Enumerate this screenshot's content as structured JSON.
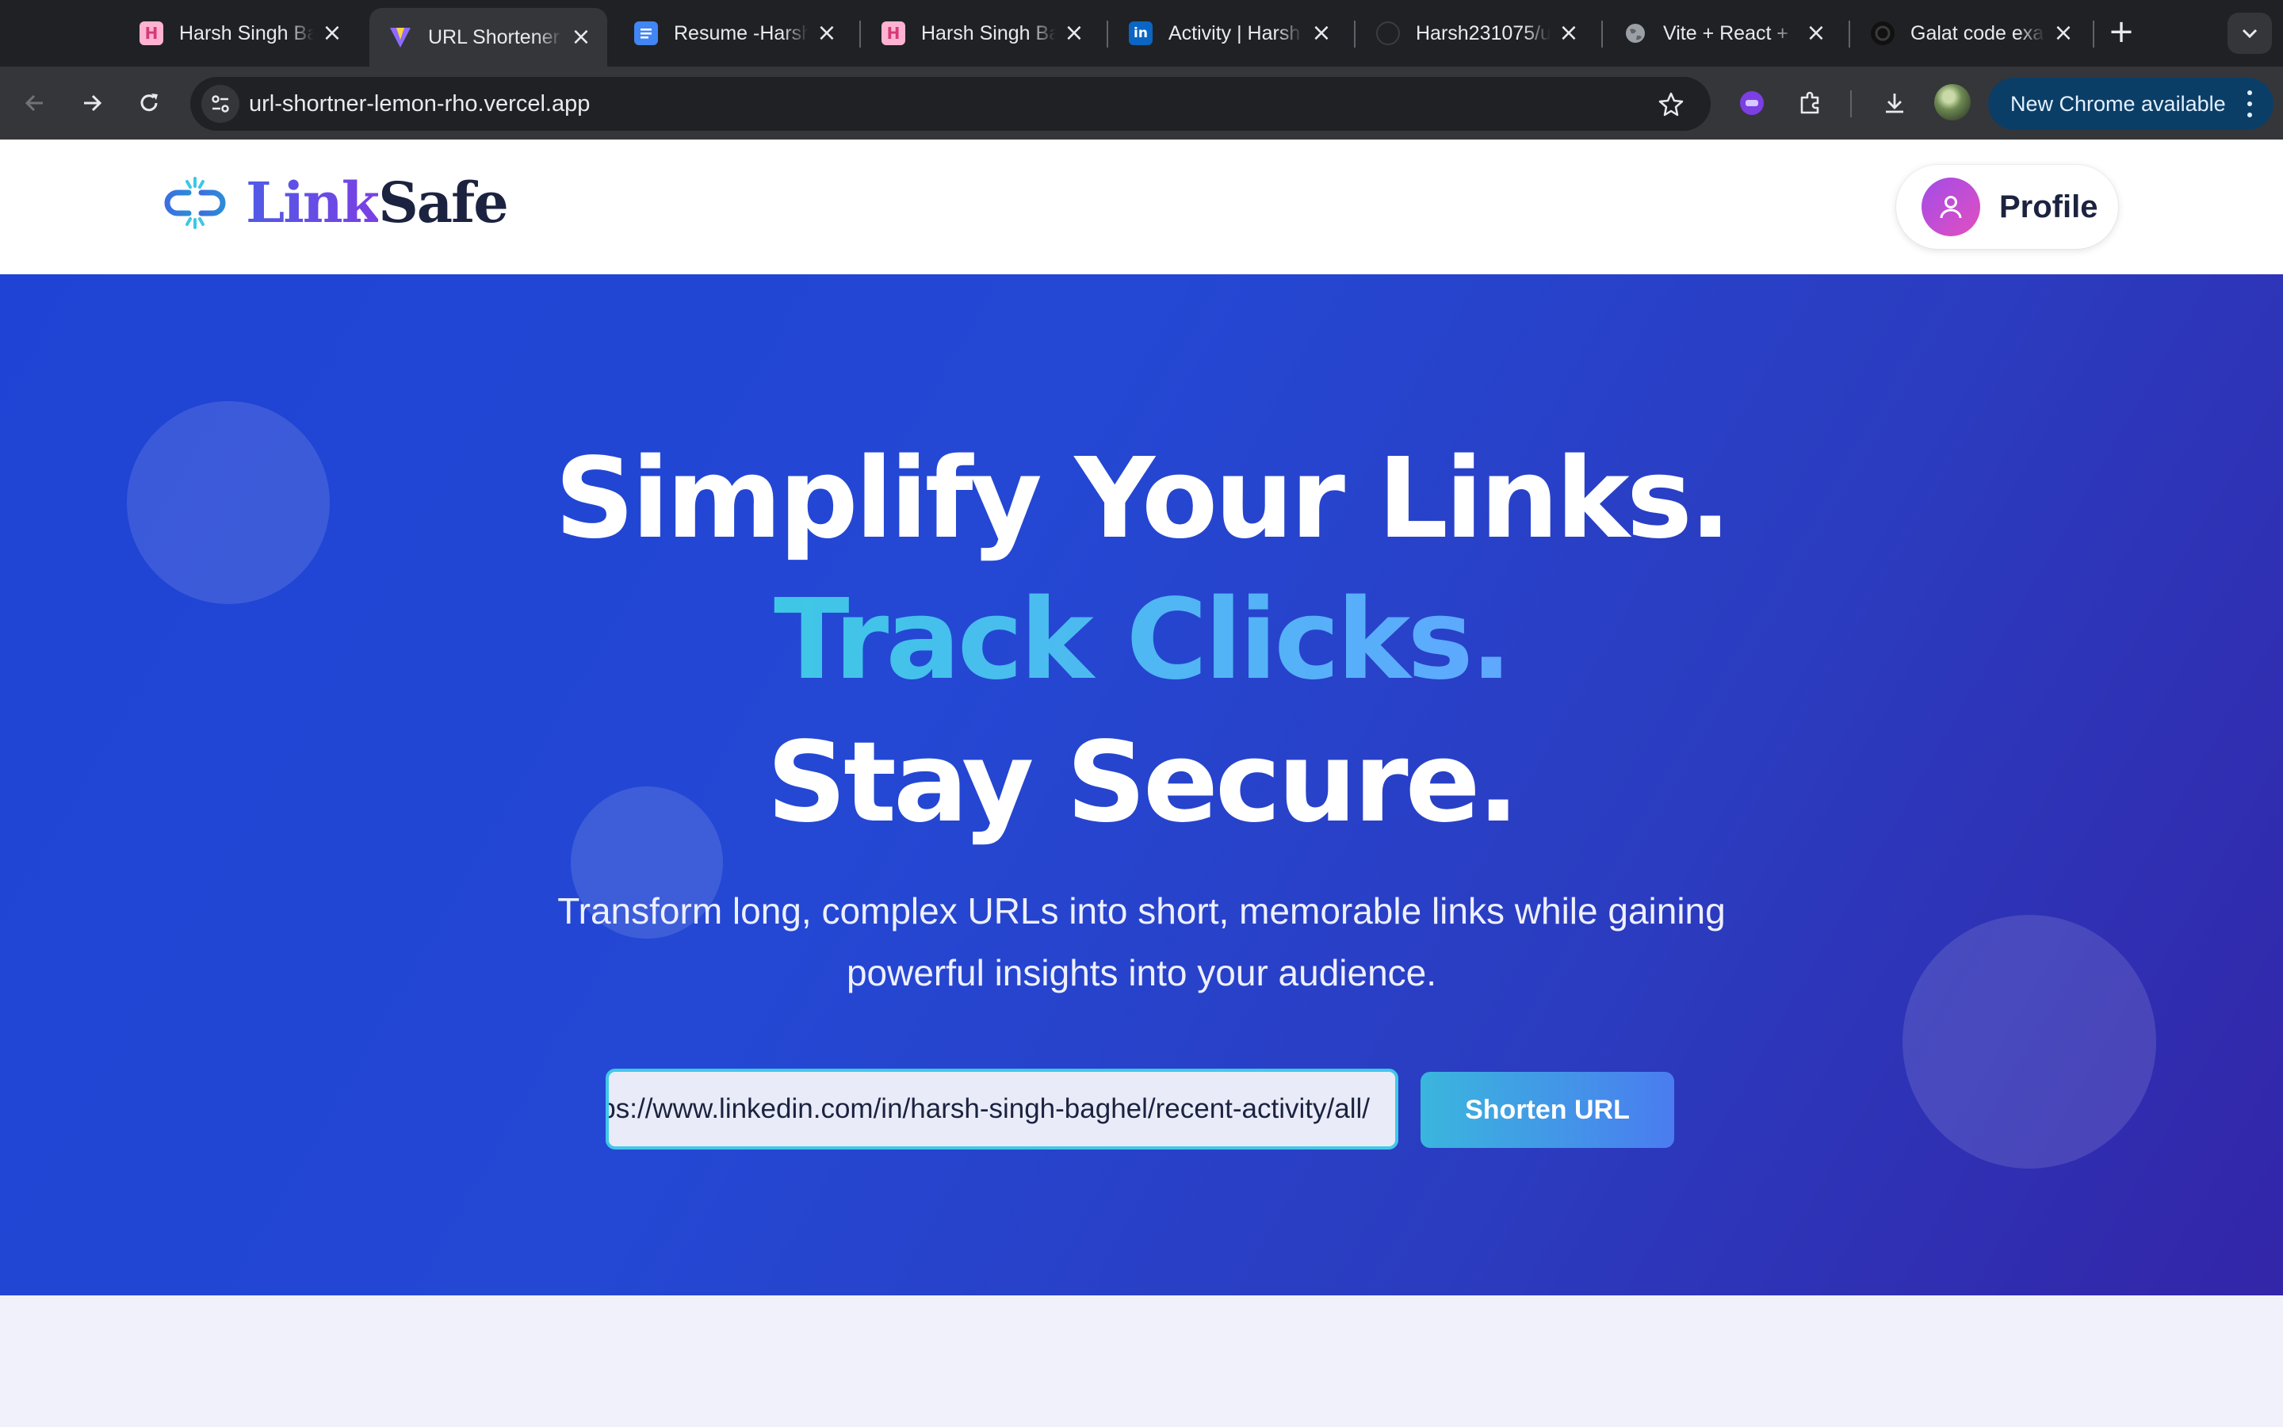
{
  "browser": {
    "tabs": [
      {
        "title": "Harsh Singh Ba",
        "favicon": "hashnode-icon",
        "active": false
      },
      {
        "title": "URL Shortener",
        "favicon": "vite-icon",
        "active": true
      },
      {
        "title": "Resume -Harsh",
        "favicon": "google-docs-icon",
        "active": false
      },
      {
        "title": "Harsh Singh Ba",
        "favicon": "hashnode-icon",
        "active": false
      },
      {
        "title": "Activity | Harsh",
        "favicon": "linkedin-icon",
        "active": false
      },
      {
        "title": "Harsh231075/u",
        "favicon": "github-icon",
        "active": false
      },
      {
        "title": "Vite + React +",
        "favicon": "globe-icon",
        "active": false
      },
      {
        "title": "Galat code exa",
        "favicon": "openai-icon",
        "active": false
      }
    ],
    "address": "url-shortner-lemon-rho.vercel.app",
    "update_label": "New Chrome available"
  },
  "site": {
    "logo_part1": "Link",
    "logo_part2": "Safe",
    "profile_label": "Profile"
  },
  "hero": {
    "line1": "Simplify Your Links.",
    "line2": "Track Clicks.",
    "line3": "Stay Secure.",
    "subtitle_line1": "Transform long, complex URLs into short, memorable links while gaining",
    "subtitle_line2": "powerful insights into your audience.",
    "input_value": "https://www.linkedin.com/in/harsh-singh-baghel/recent-activity/all/",
    "input_visible": "tps://www.linkedin.com/in/harsh-singh-baghel/recent-activity/all/",
    "button_label": "Shorten URL"
  },
  "colors": {
    "hero_start": "#1f43d4",
    "hero_end": "#3325a8",
    "accent_cyan": "#3ec7e6",
    "logo_purple": "#7b3fe4",
    "chrome_dark": "#202124"
  }
}
